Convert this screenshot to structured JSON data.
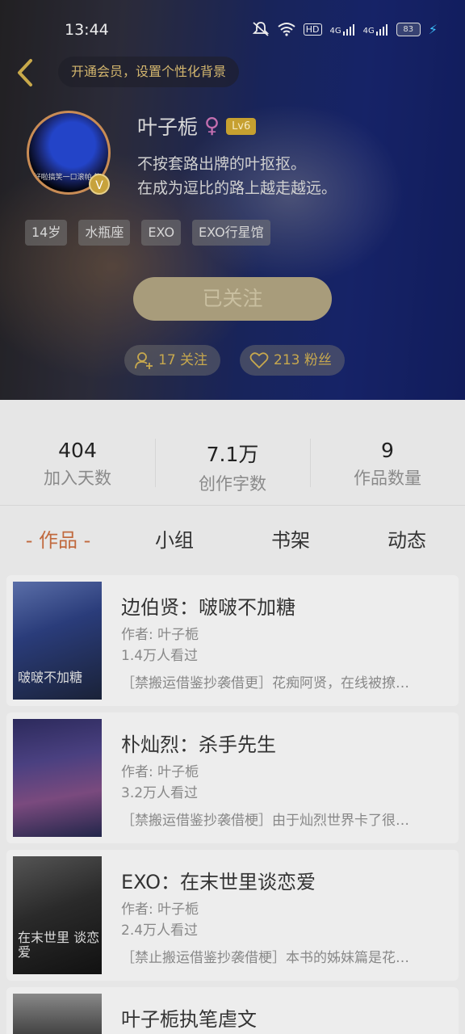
{
  "status_bar": {
    "time": "13:44",
    "hd": "HD",
    "net1": "4G",
    "net2": "4G",
    "battery": "83"
  },
  "header": {
    "member_prompt": "开通会员，设置个性化背景",
    "avatar_caption": "好啦搞笑一口滚帕 笑你",
    "verified_badge": "V",
    "username": "叶子栀",
    "gender_symbol": "♀",
    "level": "Lv6",
    "bio_line1": "不按套路出牌的叶抠抠。",
    "bio_line2": "在成为逗比的路上越走越远。",
    "tags": [
      "14岁",
      "水瓶座",
      "EXO",
      "EXO行星馆"
    ],
    "follow_button": "已关注",
    "following": "17 关注",
    "followers": "213 粉丝"
  },
  "stats": [
    {
      "value": "404",
      "label": "加入天数"
    },
    {
      "value": "7.1万",
      "label": "创作字数"
    },
    {
      "value": "9",
      "label": "作品数量"
    }
  ],
  "tabs": [
    "- 作品 -",
    "小组",
    "书架",
    "动态"
  ],
  "works": [
    {
      "title": "边伯贤：啵啵不加糖",
      "author": "作者: 叶子栀",
      "views": "1.4万人看过",
      "desc": "［禁搬运借鉴抄袭借更］花痴阿贤，在线被撩…",
      "cover_text": "啵啵不加糖"
    },
    {
      "title": "朴灿烈：杀手先生",
      "author": "作者: 叶子栀",
      "views": "3.2万人看过",
      "desc": "［禁搬运借鉴抄袭借梗］由于灿烈世界卡了很…",
      "cover_text": ""
    },
    {
      "title": "EXO：在末世里谈恋爱",
      "author": "作者: 叶子栀",
      "views": "2.4万人看过",
      "desc": "［禁止搬运借鉴抄袭借梗］本书的姊妹篇是花…",
      "cover_text": "在末世里 谈恋爱"
    },
    {
      "title": "叶子栀执笔虐文"
    }
  ],
  "colors": {
    "accent": "#c16a3f",
    "gold": "#c7a84e"
  }
}
